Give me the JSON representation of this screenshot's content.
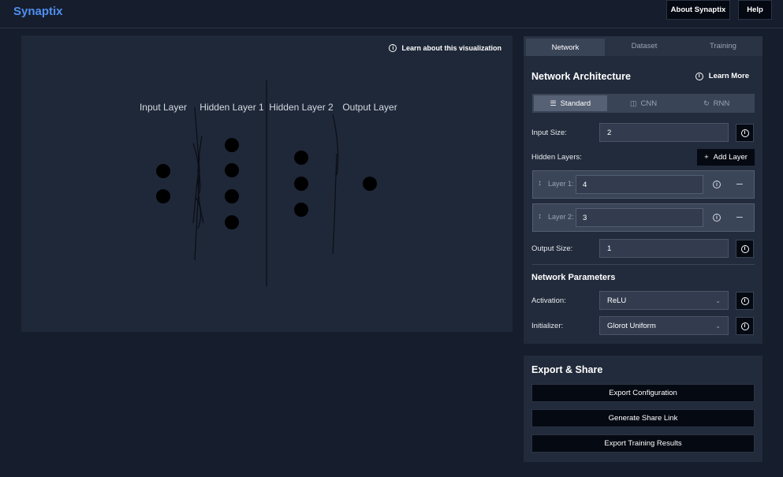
{
  "header": {
    "brand": "Synaptix",
    "about_label": "About Synaptix",
    "help_label": "Help"
  },
  "visualization": {
    "learn_label": "Learn about this visualization",
    "layers": [
      {
        "label": "Input Layer",
        "neurons": 2
      },
      {
        "label": "Hidden Layer 1",
        "neurons": 4
      },
      {
        "label": "Hidden Layer 2",
        "neurons": 3
      },
      {
        "label": "Output Layer",
        "neurons": 1
      }
    ]
  },
  "panel": {
    "tabs": [
      "Network",
      "Dataset",
      "Training"
    ],
    "active_tab": "Network",
    "architecture_title": "Network Architecture",
    "learn_more_label": "Learn More",
    "network_types": [
      "Standard",
      "CNN",
      "RNN"
    ],
    "active_network_type": "Standard",
    "input_size_label": "Input Size:",
    "input_size_value": "2",
    "hidden_layers_label": "Hidden Layers:",
    "add_layer_label": "Add Layer",
    "hidden_layers": [
      {
        "label": "Layer 1:",
        "value": "4"
      },
      {
        "label": "Layer 2:",
        "value": "3"
      }
    ],
    "output_size_label": "Output Size:",
    "output_size_value": "1",
    "parameters_title": "Network Parameters",
    "activation_label": "Activation:",
    "activation_value": "ReLU",
    "initializer_label": "Initializer:",
    "initializer_value": "Glorot Uniform"
  },
  "export": {
    "title": "Export & Share",
    "buttons": [
      "Export Configuration",
      "Generate Share Link",
      "Export Training Results"
    ]
  },
  "colors": {
    "brand": "#4f8ff0",
    "background": "#161e2d",
    "panel": "#222b3b",
    "neuron": "#000000"
  }
}
